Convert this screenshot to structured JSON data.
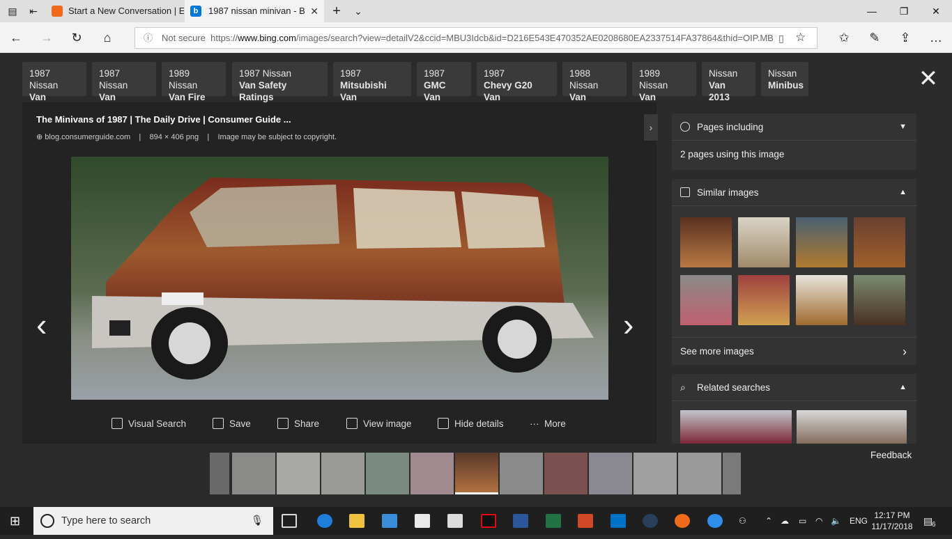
{
  "browser": {
    "tabs": [
      {
        "label": "Start a New Conversation | E"
      },
      {
        "label": "1987 nissan minivan - B"
      }
    ],
    "address": {
      "security": "Not secure",
      "prefix": "https://",
      "host": "www.bing.com",
      "path": "/images/search?view=detailV2&ccid=MBU3Idcb&id=D216E543E470352AE0208680EA2337514FA37864&thid=OIP.MB"
    },
    "accent": "#0078d7"
  },
  "related_chips": [
    {
      "line1": "1987 Nissan",
      "line2": "Van"
    },
    {
      "line1": "1987 Nissan",
      "line2": "Van Interior"
    },
    {
      "line1": "1989 Nissan",
      "line2": "Van Fire"
    },
    {
      "line1": "1987 Nissan",
      "line2": "Van Safety Ratings"
    },
    {
      "line1": "1987",
      "line2": "Mitsubishi Van"
    },
    {
      "line1": "1987",
      "line2": "GMC Van"
    },
    {
      "line1": "1987",
      "line2": "Chevy G20 Van"
    },
    {
      "line1": "1988 Nissan",
      "line2": "Van"
    },
    {
      "line1": "1989 Nissan",
      "line2": "Van"
    },
    {
      "line1": "Nissan",
      "line2": "Van 2013"
    },
    {
      "line1": "Nissan",
      "line2": "Minibus"
    }
  ],
  "image": {
    "title": "The Minivans of 1987 | The Daily Drive | Consumer Guide ...",
    "source": "blog.consumerguide.com",
    "dims": "894 × 406 png",
    "copyright": "Image may be subject to copyright."
  },
  "toolbar": {
    "visual_search": "Visual Search",
    "save": "Save",
    "share": "Share",
    "view_image": "View image",
    "hide_details": "Hide details",
    "more": "More"
  },
  "side": {
    "pages_including": {
      "title": "Pages including",
      "body": "2 pages using this image"
    },
    "similar": {
      "title": "Similar images",
      "see_more": "See more images"
    },
    "related": {
      "title": "Related searches"
    }
  },
  "feedback": "Feedback",
  "taskbar": {
    "search_placeholder": "Type here to search",
    "lang": "ENG",
    "time": "12:17 PM",
    "date": "11/17/2018",
    "notifications": "6"
  }
}
